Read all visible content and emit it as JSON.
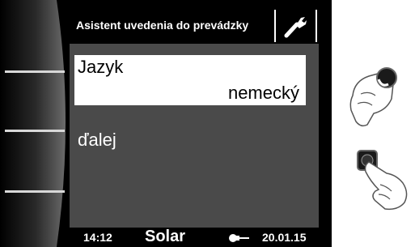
{
  "header": {
    "title": "Asistent uvedenia do prevádzky",
    "icon": "wrench-icon"
  },
  "menu": {
    "selected_item": {
      "label": "Jazyk",
      "value": "nemecký"
    },
    "next_item": {
      "label": "ďalej"
    }
  },
  "status": {
    "time": "14:12",
    "mode": "Solar",
    "date": "20.01.15",
    "icon": "plug-icon"
  },
  "controls": {
    "rotate_icon": "rotary-knob-hand-icon",
    "press_icon": "press-button-hand-icon"
  },
  "colors": {
    "screen_bg": "#4a4a4a",
    "bar_bg": "#000000",
    "highlight_bg": "#ffffff"
  }
}
